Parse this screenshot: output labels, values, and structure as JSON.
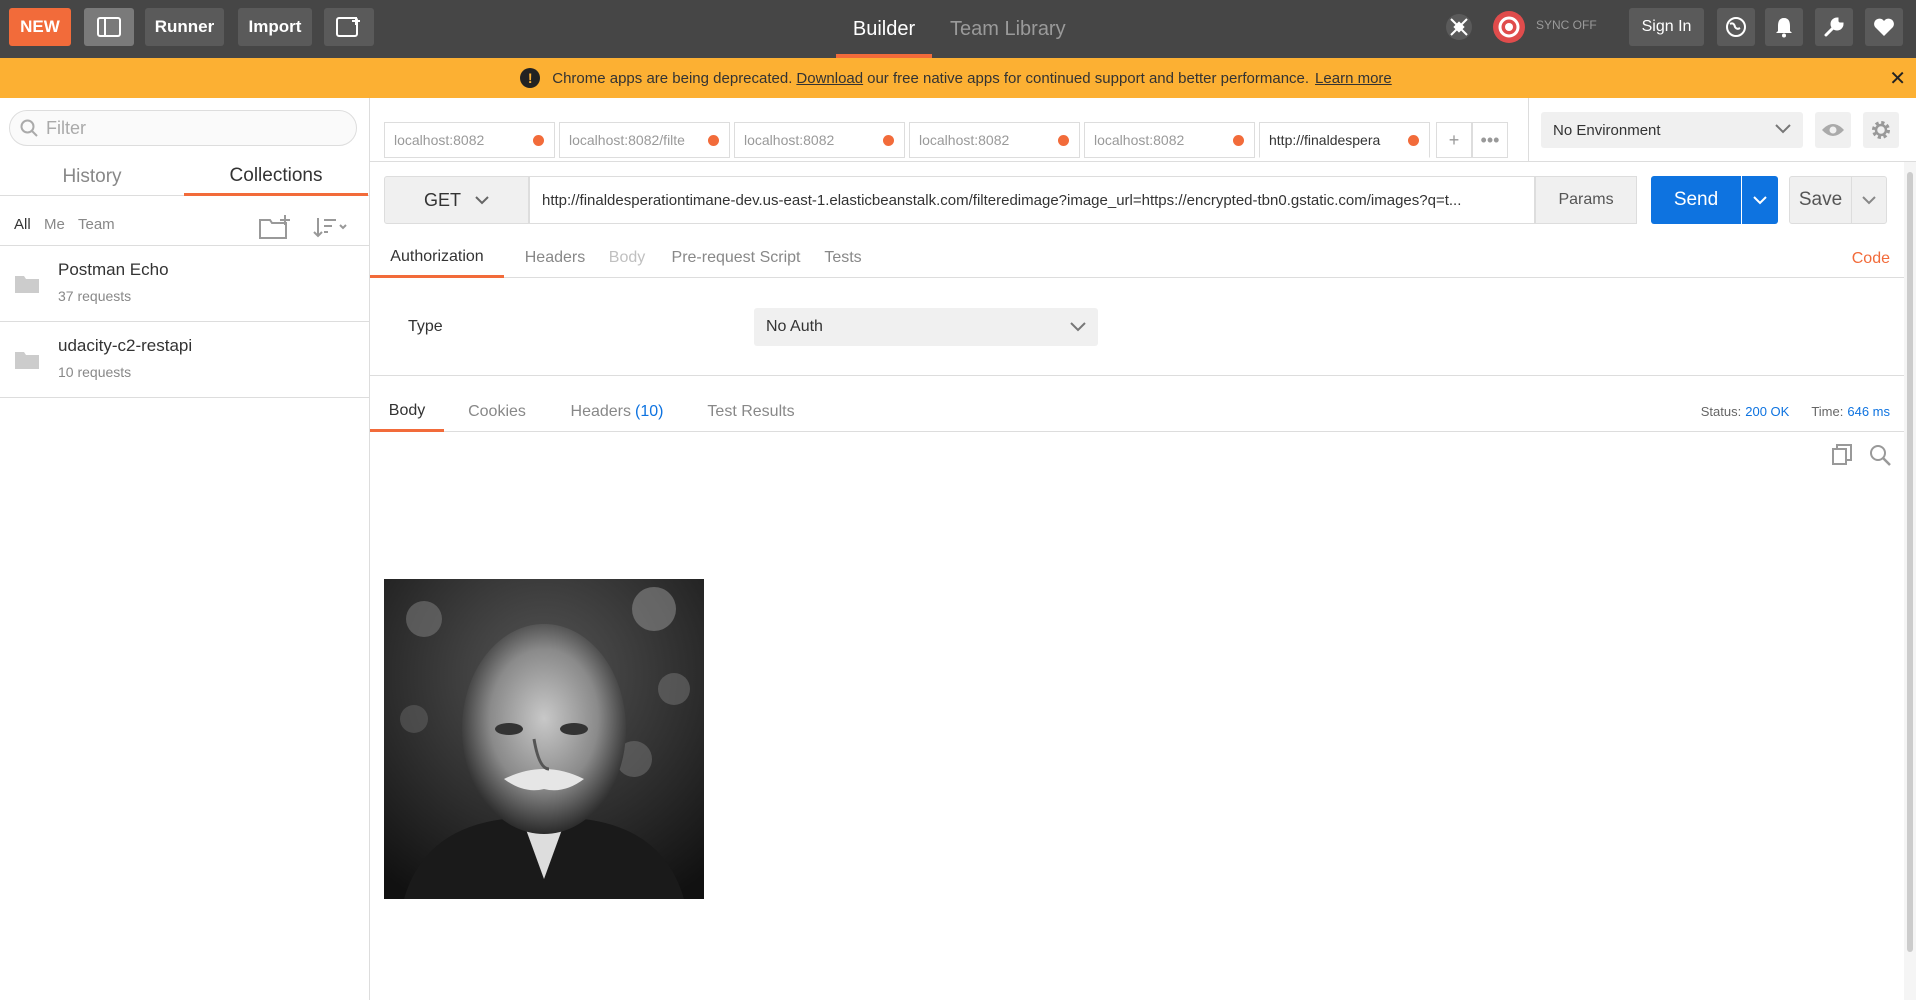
{
  "topbar": {
    "new_label": "NEW",
    "runner_label": "Runner",
    "import_label": "Import",
    "tabs": [
      "Builder",
      "Team Library"
    ],
    "sync_label": "SYNC OFF",
    "signin_label": "Sign In"
  },
  "banner": {
    "text_before": "Chrome apps are being deprecated.",
    "download_link": "Download",
    "text_after": "our free native apps for continued support and better performance.",
    "learn_more": "Learn more"
  },
  "sidebar": {
    "filter_placeholder": "Filter",
    "tabs": [
      "History",
      "Collections"
    ],
    "filters": [
      "All",
      "Me",
      "Team"
    ],
    "collections": [
      {
        "name": "Postman Echo",
        "count": "37 requests"
      },
      {
        "name": "udacity-c2-restapi",
        "count": "10 requests"
      }
    ]
  },
  "request_tabs": [
    {
      "label": "localhost:8082"
    },
    {
      "label": "localhost:8082/filte"
    },
    {
      "label": "localhost:8082"
    },
    {
      "label": "localhost:8082"
    },
    {
      "label": "localhost:8082"
    },
    {
      "label": "http://finaldespera"
    }
  ],
  "environment": {
    "selected": "No Environment"
  },
  "request": {
    "method": "GET",
    "url": "http://finaldesperationtimane-dev.us-east-1.elasticbeanstalk.com/filteredimage?image_url=https://encrypted-tbn0.gstatic.com/images?q=t...",
    "params_label": "Params",
    "send_label": "Send",
    "save_label": "Save"
  },
  "request_subtabs": [
    "Authorization",
    "Headers",
    "Body",
    "Pre-request Script",
    "Tests"
  ],
  "code_label": "Code",
  "auth": {
    "type_label": "Type",
    "type_value": "No Auth"
  },
  "response": {
    "tabs": {
      "body": "Body",
      "cookies": "Cookies",
      "headers": "Headers",
      "headers_count": "(10)",
      "test_results": "Test Results"
    },
    "status_label": "Status:",
    "status_value": "200 OK",
    "time_label": "Time:",
    "time_value": "646 ms"
  }
}
